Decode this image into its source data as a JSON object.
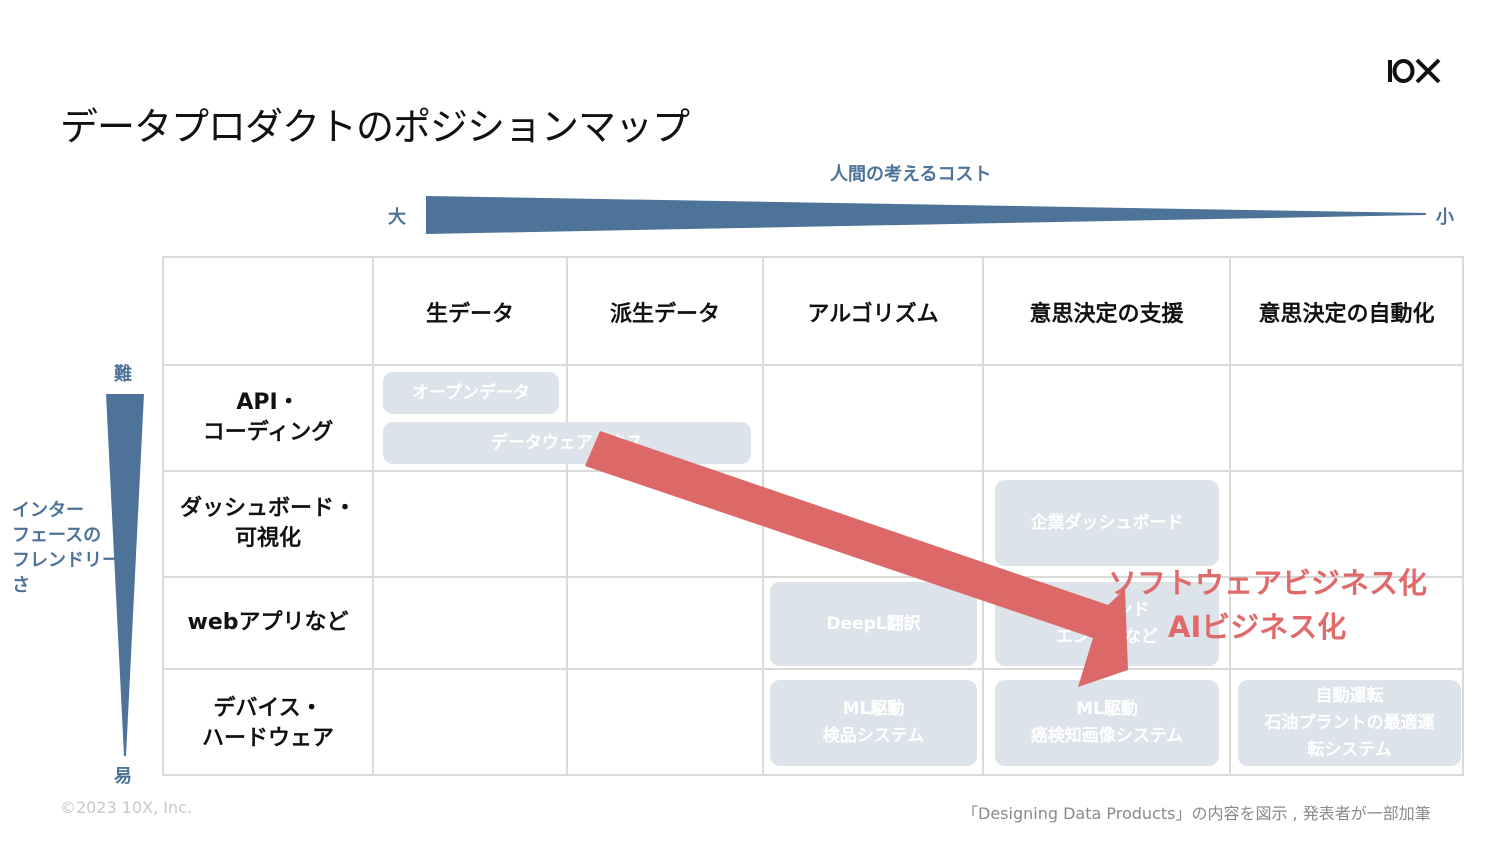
{
  "logo": "10X",
  "title": "データプロダクトのポジションマップ",
  "cost_axis": {
    "label": "人間の考えるコスト",
    "high": "大",
    "low": "小"
  },
  "ease_axis": {
    "hard": "難",
    "easy": "易",
    "label": "インター\nフェースの\nフレンドリー\nさ"
  },
  "columns": [
    "生データ",
    "派生データ",
    "アルゴリズム",
    "意思決定の支援",
    "意思決定の自動化"
  ],
  "rows": [
    "API・\nコーディング",
    "ダッシュボード・\n可視化",
    "webアプリなど",
    "デバイス・\nハードウェア"
  ],
  "items": {
    "open_data": "オープンデータ",
    "data_warehouse": "データウェアハウス",
    "enterprise_dashboard": "企業ダッシュボード",
    "deepl": "DeepL翻訳",
    "recommend": "レコメンド\nエンジンなど",
    "ml_inspection": "ML駆動\n検品システム",
    "ml_cancer": "ML駆動\n癌検知画像システム",
    "autonomous": "自動運転\n石油プラントの最適運\n転システム"
  },
  "business_labels": [
    "ソフトウェアビジネス化",
    "AIビジネス化"
  ],
  "colors": {
    "axis_blue": "#4d7399",
    "arrow_red": "#dd6868",
    "box_gray": "#dde3ea",
    "grid": "#d9d9d9"
  },
  "footer": {
    "copyright": "©2023 10X, Inc.",
    "source": "「Designing Data Products」の内容を図示 , 発表者が一部加筆"
  }
}
